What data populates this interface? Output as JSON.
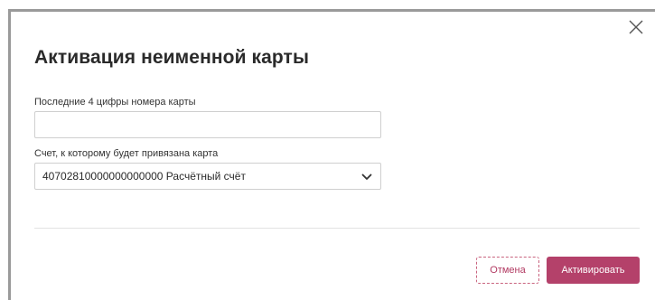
{
  "dialog": {
    "title": "Активация неименной карты",
    "close_icon": "close-icon"
  },
  "form": {
    "card_digits": {
      "label": "Последние 4 цифры номера карты",
      "value": "",
      "placeholder": ""
    },
    "account": {
      "label": "Счет, к которому будет привязана карта",
      "selected": "40702810000000000000 Расчётный счёт",
      "icon": "chevron-down-icon"
    }
  },
  "actions": {
    "cancel_label": "Отмена",
    "activate_label": "Активировать"
  },
  "colors": {
    "accent": "#b4416a",
    "accent_text": "#b23a62",
    "dialog_border": "#9a9a9a",
    "field_border": "#cfcfcf",
    "divider": "#e2e2e2"
  }
}
